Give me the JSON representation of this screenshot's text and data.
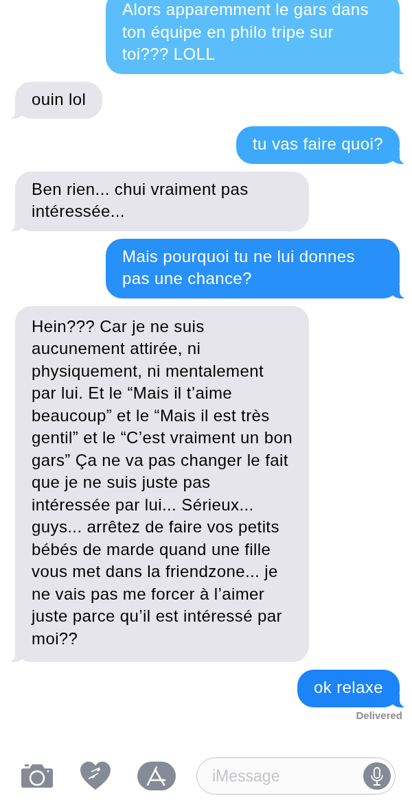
{
  "messages": [
    {
      "kind": "sent",
      "text": "Alors apparemment le gars dans ton équipe en philo tripe sur toi??? LOLL"
    },
    {
      "kind": "received",
      "text": "ouin lol"
    },
    {
      "kind": "sent",
      "text": "tu vas faire quoi?"
    },
    {
      "kind": "received",
      "text": "Ben rien... chui vraiment pas intéressée..."
    },
    {
      "kind": "sent",
      "text": "Mais pourquoi tu ne lui donnes pas une chance?"
    },
    {
      "kind": "received",
      "text": "Hein??? Car je ne suis aucunement attirée, ni physiquement, ni mentalement par lui. Et le “Mais il t’aime beaucoup” et le “Mais il est très gentil” et le “C’est vraiment un bon gars” Ça ne va pas changer le fait que je ne suis juste pas intéressée par lui... Sérieux... guys... arrêtez de faire vos petits bébés de marde quand une fille vous met dans la friendzone... je ne vais pas me forcer à l’aimer juste parce qu’il est intéressé par moi??"
    },
    {
      "kind": "sent",
      "text": "ok relaxe"
    }
  ],
  "status": "Delivered",
  "composer": {
    "placeholder": "iMessage"
  }
}
